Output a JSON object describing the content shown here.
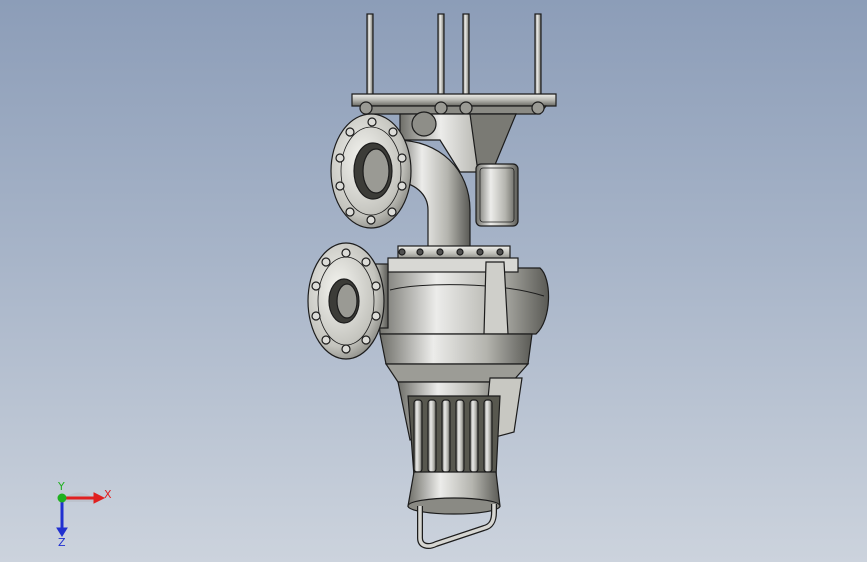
{
  "viewport": {
    "background_top": "#8c9db8",
    "background_bottom": "#ccd3dd"
  },
  "model": {
    "icon": "pump-assembly-model",
    "metal_light": "#e4e4e0",
    "metal_mid": "#a9a9a3",
    "metal_dark": "#4d4d48",
    "edge": "#1c1c1c"
  },
  "triad": {
    "x_label": "X",
    "y_label": "Y",
    "z_label": "Z",
    "x_color": "#e02020",
    "y_color": "#20b020",
    "z_color": "#2030d0"
  }
}
